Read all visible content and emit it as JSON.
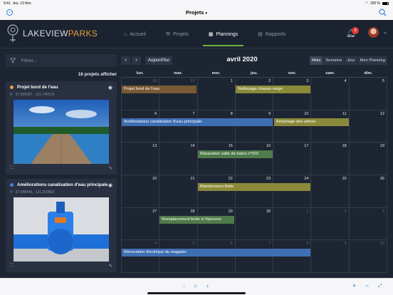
{
  "status": {
    "time": "9:41",
    "date": "Jeu. 13 févr.",
    "battery": "100 %"
  },
  "nav": {
    "title": "Projets",
    "title_chevron": "▾"
  },
  "brand": {
    "part1": "LAKEVIEW",
    "part2": "PARKS",
    "accent": "#e3a23a"
  },
  "tabs": [
    {
      "label": "Accueil",
      "icon": "⌂"
    },
    {
      "label": "Projets",
      "icon": "⚒"
    },
    {
      "label": "Plannings",
      "icon": "▦"
    },
    {
      "label": "Rapports",
      "icon": "▤"
    }
  ],
  "notifications": {
    "count": "3"
  },
  "filter": {
    "placeholder": "Filtrer..."
  },
  "projects": {
    "count_label": "16 projets afficher",
    "items": [
      {
        "title": "Projet bord de l'eau",
        "color": "#f0a040",
        "coords": "37.506997, -121.740214"
      },
      {
        "title": "Améliorations canalisation d'eau principale",
        "color": "#3f86d8",
        "coords": "37.548446, -121.152802"
      }
    ]
  },
  "calendar": {
    "month": "avril 2020",
    "today_label": "Aujourd'hui",
    "prev": "‹",
    "next": "›",
    "views": [
      "Mois",
      "Semaine",
      "Jour",
      "Mon Planning"
    ],
    "weekdays": [
      "lun.",
      "mar.",
      "mer.",
      "jeu.",
      "ven.",
      "sam.",
      "dim."
    ],
    "days": [
      [
        "30",
        "31",
        "1",
        "2",
        "3",
        "4",
        "5"
      ],
      [
        "6",
        "7",
        "8",
        "9",
        "10",
        "11",
        "12"
      ],
      [
        "13",
        "14",
        "15",
        "16",
        "17",
        "18",
        "19"
      ],
      [
        "20",
        "21",
        "22",
        "23",
        "24",
        "25",
        "26"
      ],
      [
        "27",
        "28",
        "29",
        "30",
        "1",
        "2",
        "3"
      ],
      [
        "4",
        "5",
        "6",
        "7",
        "8",
        "9",
        "10"
      ]
    ],
    "events": [
      {
        "title": "Projet bord de l'eau",
        "color": "#7a5a34",
        "week": 0,
        "start": 0,
        "span": 2
      },
      {
        "title": "Nettoyage chasse-neige",
        "color": "#8a8a3a",
        "week": 0,
        "start": 3,
        "span": 2
      },
      {
        "title": "Améliorations canalisation d'eau principale",
        "color": "#3f6fb3",
        "week": 1,
        "start": 0,
        "span": 4
      },
      {
        "title": "Arrachage des arbres",
        "color": "#8a8a3a",
        "week": 1,
        "start": 4,
        "span": 2
      },
      {
        "title": "Réparation salle de bains n°502",
        "color": "#4f7a4a",
        "week": 2,
        "start": 2,
        "span": 2
      },
      {
        "title": "Maintenance flotte",
        "color": "#8a8a3a",
        "week": 3,
        "start": 2,
        "span": 3
      },
      {
        "title": "Remplacement boîte à l'épreuve",
        "color": "#4f7a4a",
        "week": 4,
        "start": 1,
        "span": 2
      },
      {
        "title": "Rénovation électrique du magasin",
        "color": "#3f6fb3",
        "week": 5,
        "start": 0,
        "span": 5
      }
    ]
  }
}
